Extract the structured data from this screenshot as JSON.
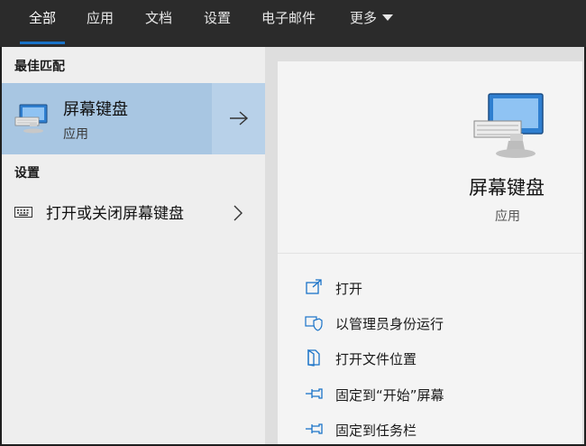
{
  "tabs": [
    {
      "label": "全部",
      "active": true
    },
    {
      "label": "应用"
    },
    {
      "label": "文档"
    },
    {
      "label": "设置"
    },
    {
      "label": "电子邮件"
    },
    {
      "label": "更多"
    }
  ],
  "accent_color": "#1a73c8",
  "best_match": {
    "header": "最佳匹配",
    "title": "屏幕键盘",
    "subtitle": "应用",
    "icon": "on-screen-keyboard-icon",
    "arrow_icon": "arrow-right-icon"
  },
  "settings": {
    "header": "设置",
    "items": [
      {
        "label": "打开或关闭屏幕键盘",
        "icon": "keyboard-icon"
      }
    ]
  },
  "detail": {
    "title": "屏幕键盘",
    "subtitle": "应用",
    "actions": [
      {
        "label": "打开",
        "icon": "open-icon"
      },
      {
        "label": "以管理员身份运行",
        "icon": "shield-icon"
      },
      {
        "label": "打开文件位置",
        "icon": "folder-icon"
      },
      {
        "label": "固定到“开始”屏幕",
        "icon": "pin-icon"
      },
      {
        "label": "固定到任务栏",
        "icon": "pin-icon"
      }
    ]
  }
}
